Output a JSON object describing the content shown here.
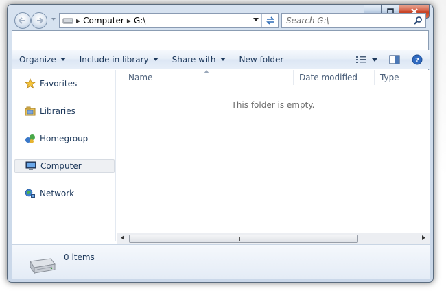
{
  "address_bar": {
    "crumbs": [
      "Computer",
      "G:\\"
    ]
  },
  "search": {
    "placeholder": "Search G:\\"
  },
  "toolbar": {
    "organize": "Organize",
    "include_in_library": "Include in library",
    "share_with": "Share with",
    "new_folder": "New folder"
  },
  "navigation_pane": {
    "items": [
      {
        "label": "Favorites",
        "icon": "star-icon"
      },
      {
        "label": "Libraries",
        "icon": "libraries-icon"
      },
      {
        "label": "Homegroup",
        "icon": "homegroup-icon"
      },
      {
        "label": "Computer",
        "icon": "computer-icon",
        "selected": true
      },
      {
        "label": "Network",
        "icon": "network-icon"
      }
    ]
  },
  "file_list": {
    "columns": [
      "Name",
      "Date modified",
      "Type"
    ],
    "empty_message": "This folder is empty."
  },
  "details_pane": {
    "item_count": "0 items"
  },
  "colors": {
    "accent_text": "#1e395b",
    "frame": "#c8d6e8",
    "close_button": "#c23a1c",
    "selection": "#eef0f3"
  }
}
